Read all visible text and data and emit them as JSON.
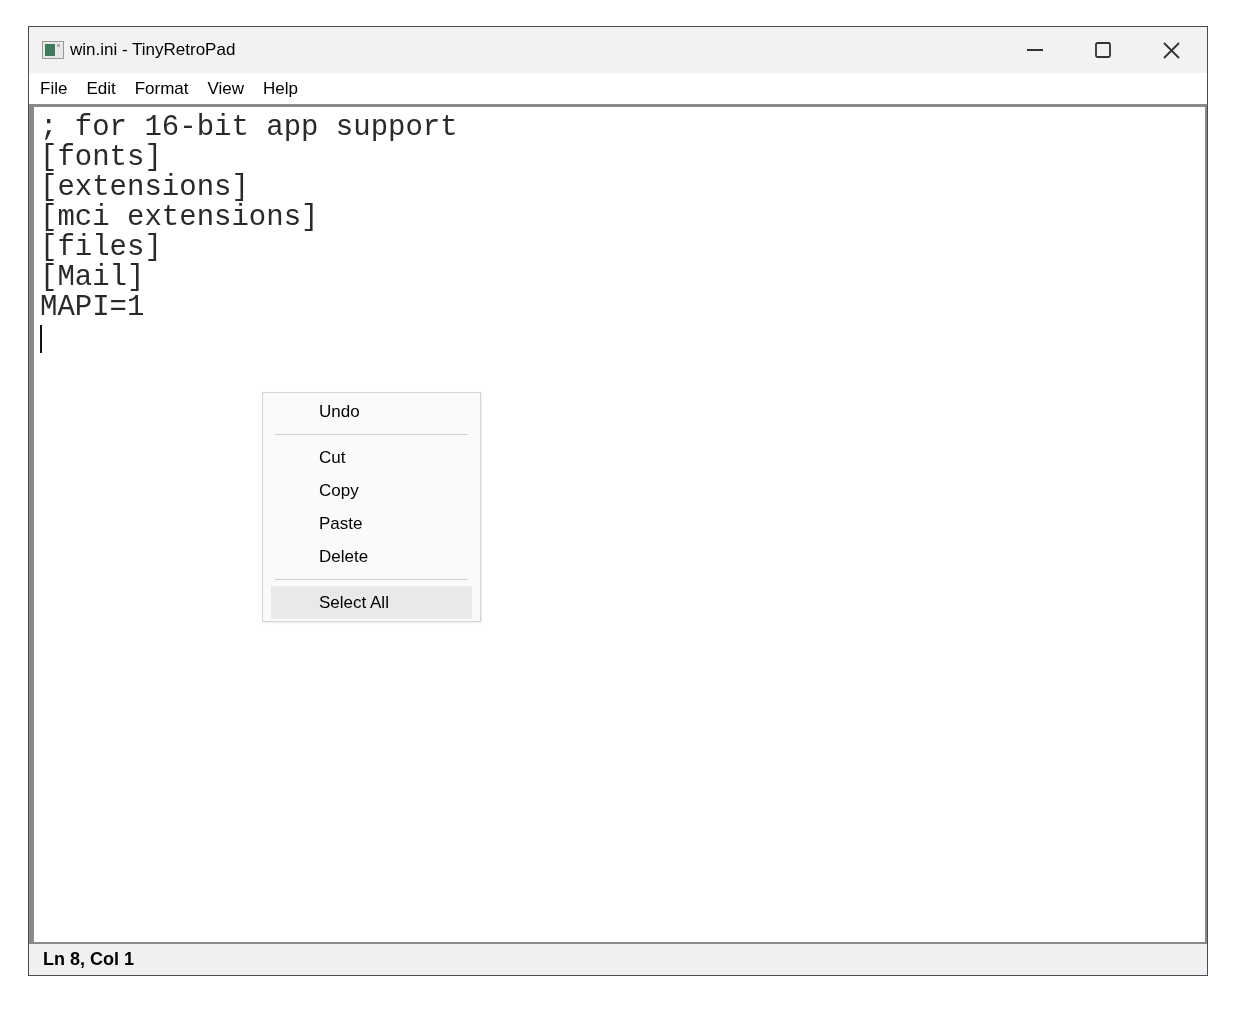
{
  "window": {
    "title": "win.ini - TinyRetroPad"
  },
  "menu_bar": [
    {
      "label": "File"
    },
    {
      "label": "Edit"
    },
    {
      "label": "Format"
    },
    {
      "label": "View"
    },
    {
      "label": "Help"
    }
  ],
  "editor": {
    "lines": [
      "; for 16-bit app support",
      "[fonts]",
      "[extensions]",
      "[mci extensions]",
      "[files]",
      "[Mail]",
      "MAPI=1"
    ]
  },
  "context_menu": {
    "items": [
      {
        "kind": "item",
        "label": "Undo",
        "selected": false
      },
      {
        "kind": "separator"
      },
      {
        "kind": "item",
        "label": "Cut",
        "selected": false
      },
      {
        "kind": "item",
        "label": "Copy",
        "selected": false
      },
      {
        "kind": "item",
        "label": "Paste",
        "selected": false
      },
      {
        "kind": "item",
        "label": "Delete",
        "selected": false
      },
      {
        "kind": "separator"
      },
      {
        "kind": "item",
        "label": "Select All",
        "selected": true
      }
    ]
  },
  "status_bar": {
    "position": "Ln 8, Col 1"
  }
}
